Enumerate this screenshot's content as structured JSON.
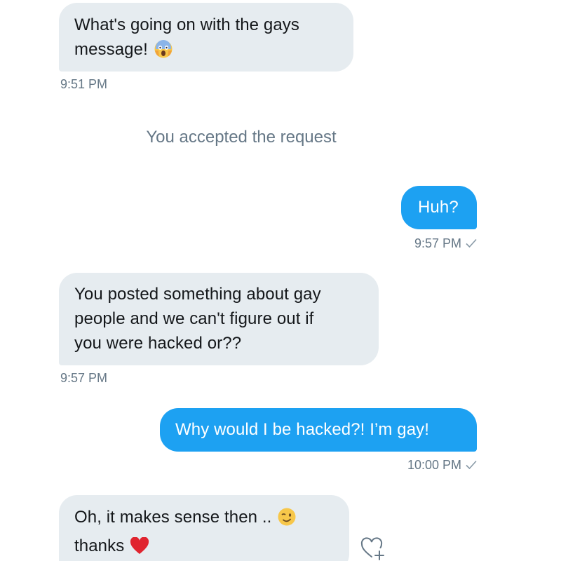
{
  "conversation": {
    "messages": [
      {
        "direction": "in",
        "lines": [
          "What's going on with the gays",
          "message!"
        ],
        "emoji": "face-screaming-in-fear-icon",
        "time": "9:51 PM"
      },
      {
        "direction": "system",
        "text": "You accepted the request"
      },
      {
        "direction": "out",
        "lines": [
          "Huh?"
        ],
        "time": "9:57 PM"
      },
      {
        "direction": "in",
        "lines": [
          "You posted something about gay",
          "people and we can't figure out if",
          "you were hacked or??"
        ],
        "time": "9:57 PM"
      },
      {
        "direction": "out",
        "lines": [
          "Why would I be hacked?! I’m gay!"
        ],
        "time": "10:00 PM"
      },
      {
        "direction": "in",
        "lines": [
          "Oh, it makes sense then ..",
          "thanks"
        ],
        "emoji": [
          "winking-face-icon",
          "red-heart-icon"
        ]
      }
    ]
  },
  "colors": {
    "incoming_bubble": "#e6ecf0",
    "outgoing_bubble": "#1da1f2",
    "meta_text": "#657786",
    "message_text": "#14171a"
  },
  "icons": {
    "sent_indicator": "checkmark-icon",
    "reaction_button": "heart-plus-icon"
  }
}
